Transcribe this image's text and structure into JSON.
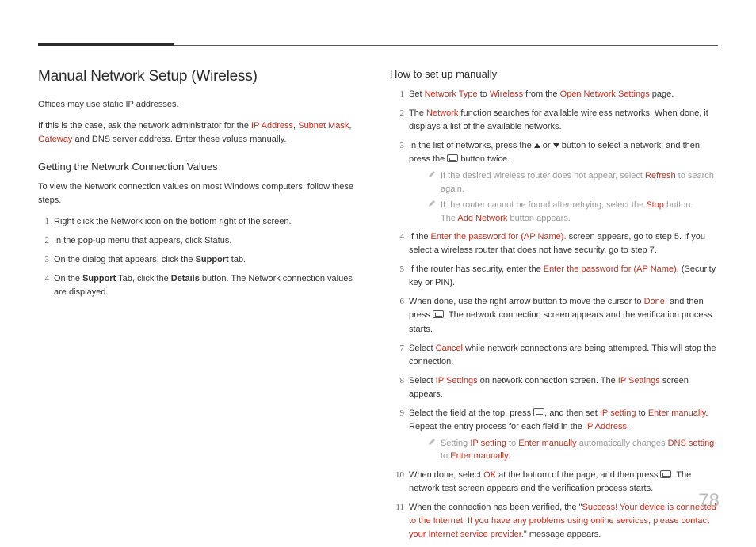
{
  "page_number": "78",
  "left": {
    "h1": "Manual Network Setup (Wireless)",
    "p1_a": "Offices may use static IP addresses.",
    "p2_a": "If this is the case, ask the network administrator for the ",
    "p2_ip": "IP Address",
    "p2_c1": ", ",
    "p2_subnet": "Subnet Mask",
    "p2_c2": ", ",
    "p2_gateway": "Gateway",
    "p2_b": " and DNS server address. Enter these values manually.",
    "h2": "Getting the Network Connection Values",
    "p3": "To view the Network connection values on most Windows computers, follow these steps.",
    "steps": {
      "s1": "Right click the Network icon on the bottom right of the screen.",
      "s2": "In the pop-up menu that appears, click Status.",
      "s3_a": "On the dialog that appears, click the ",
      "s3_b": "Support",
      "s3_c": " tab.",
      "s4_a": "On the ",
      "s4_b": "Support",
      "s4_c": " Tab, click the ",
      "s4_d": "Details",
      "s4_e": " button. The Network connection values are displayed."
    }
  },
  "right": {
    "h2": "How to set up manually",
    "s1_a": "Set ",
    "s1_nt": "Network Type",
    "s1_b": " to ",
    "s1_w": "Wireless",
    "s1_c": " from the ",
    "s1_ons": "Open Network Settings",
    "s1_d": " page.",
    "s2_a": "The ",
    "s2_net": "Network",
    "s2_b": " function searches for available wireless networks. When done, it displays a list of the available networks.",
    "s3_a": "In the list of networks, press the ",
    "s3_b": " or ",
    "s3_c": " button to select a network, and then press the ",
    "s3_d": " button twice.",
    "n3a_a": "If the desired wireless router does not appear, select ",
    "n3a_r": "Refresh",
    "n3a_b": " to search again.",
    "n3b_a": "If the router cannot be found after retrying, select the ",
    "n3b_stop": "Stop",
    "n3b_b": " button.",
    "n3b_c": "The ",
    "n3b_add": "Add Network",
    "n3b_d": " button appears.",
    "s4_a": "If the ",
    "s4_pw": "Enter the password for (AP Name).",
    "s4_b": " screen appears, go to step 5. If you select a wireless router that does not have security, go to step 7.",
    "s5_a": "If the router has security, enter the ",
    "s5_pw": "Enter the password for (AP Name).",
    "s5_b": " (Security key or PIN).",
    "s6_a": "When done, use the right arrow button to move the cursor to ",
    "s6_done": "Done",
    "s6_b": ", and then press ",
    "s6_c": ". The network connection screen appears and the verification process starts.",
    "s7_a": "Select ",
    "s7_cancel": "Cancel",
    "s7_b": " while network connections are being attempted. This will stop the connection.",
    "s8_a": "Select ",
    "s8_ips": "IP Settings",
    "s8_b": " on network connection screen. The ",
    "s8_ips2": "IP Settings",
    "s8_c": " screen appears.",
    "s9_a": "Select the field at the top, press ",
    "s9_b": ", and then set ",
    "s9_ipset": "IP setting",
    "s9_c": " to ",
    "s9_em": "Enter manually",
    "s9_d": ". Repeat the entry process for each field in the ",
    "s9_ipaddr": "IP Address",
    "s9_e": ".",
    "n9_a": "Setting ",
    "n9_ipset": "IP setting",
    "n9_b": " to ",
    "n9_em": "Enter manually",
    "n9_c": " automatically changes ",
    "n9_dns": "DNS setting",
    "n9_d": " to ",
    "n9_em2": "Enter manually",
    "n9_e": ".",
    "s10_a": "When done, select ",
    "s10_ok": "OK",
    "s10_b": " at the bottom of the page, and then press ",
    "s10_c": ". The network test screen appears and the verification process starts.",
    "s11_a": "When the connection has been verified, the \"",
    "s11_msg": "Success! Your device is connected to the Internet. If you have any problems using online services, please contact your Internet service provider.",
    "s11_b": "\" message appears."
  }
}
